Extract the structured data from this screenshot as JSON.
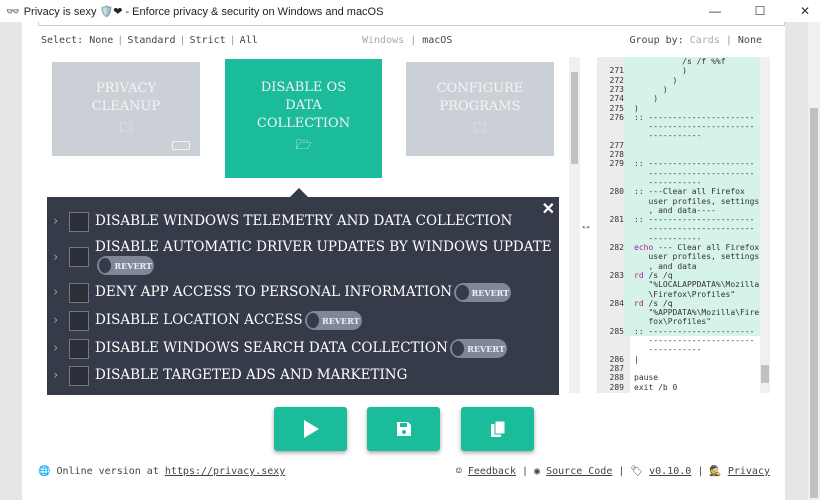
{
  "window": {
    "title": "Privacy is sexy 🛡️❤ - Enforce privacy & security on Windows and macOS",
    "minimize": "—",
    "maximize": "☐",
    "close": "✕"
  },
  "select": {
    "label": "Select:",
    "options": [
      "None",
      "Standard",
      "Strict",
      "All"
    ]
  },
  "os": {
    "options": [
      "Windows",
      "macOS"
    ],
    "selected": "macOS"
  },
  "group": {
    "label": "Group by:",
    "options": [
      "Cards",
      "None"
    ],
    "selected": "None"
  },
  "cards": [
    {
      "title": "PRIVACY CLEANUP",
      "icon": "folder-icon"
    },
    {
      "title": "DISABLE OS DATA COLLECTION",
      "icon": "folder-open-icon",
      "active": true
    },
    {
      "title": "CONFIGURE PROGRAMS",
      "icon": "folder-icon"
    }
  ],
  "scripts": {
    "close": "✕",
    "revert_label": "REVERT",
    "items": [
      {
        "label": "DISABLE WINDOWS TELEMETRY AND DATA COLLECTION",
        "revert": false
      },
      {
        "label": "DISABLE AUTOMATIC DRIVER UPDATES BY WINDOWS UPDATE",
        "revert": true
      },
      {
        "label": "DENY APP ACCESS TO PERSONAL INFORMATION",
        "revert": true
      },
      {
        "label": "DISABLE LOCATION ACCESS",
        "revert": true
      },
      {
        "label": "DISABLE WINDOWS SEARCH DATA COLLECTION",
        "revert": true
      },
      {
        "label": "DISABLE TARGETED ADS AND MARKETING",
        "revert": false
      }
    ]
  },
  "code": {
    "lines": [
      {
        "n": "",
        "t": "          /s /f %%f",
        "hl": true
      },
      {
        "n": "271",
        "t": "          )",
        "hl": true
      },
      {
        "n": "272",
        "t": "        )",
        "hl": true
      },
      {
        "n": "273",
        "t": "      )",
        "hl": true
      },
      {
        "n": "274",
        "t": "    )",
        "hl": true
      },
      {
        "n": "275",
        "t": ")",
        "hl": true
      },
      {
        "n": "276",
        "t": ":: ----------------------",
        "hl": true,
        "cls": "cm"
      },
      {
        "n": "",
        "t": "   ----------------------",
        "hl": true,
        "cls": "cm"
      },
      {
        "n": "",
        "t": "   -----------",
        "hl": true,
        "cls": "cm"
      },
      {
        "n": "277",
        "t": "",
        "hl": true
      },
      {
        "n": "278",
        "t": "",
        "hl": true
      },
      {
        "n": "279",
        "t": ":: ----------------------",
        "hl": true,
        "cls": "cm"
      },
      {
        "n": "",
        "t": "   ----------------------",
        "hl": true,
        "cls": "cm"
      },
      {
        "n": "",
        "t": "   -----------",
        "hl": true,
        "cls": "cm"
      },
      {
        "n": "280",
        "t": ":: ---Clear all Firefox",
        "hl": true,
        "cls": "cm"
      },
      {
        "n": "",
        "t": "   user profiles, settings",
        "hl": true,
        "cls": "cm"
      },
      {
        "n": "",
        "t": "   , and data----",
        "hl": true,
        "cls": "cm"
      },
      {
        "n": "281",
        "t": ":: ----------------------",
        "hl": true,
        "cls": "cm"
      },
      {
        "n": "",
        "t": "   ----------------------",
        "hl": true,
        "cls": "cm"
      },
      {
        "n": "",
        "t": "   -----------",
        "hl": true,
        "cls": "cm"
      },
      {
        "n": "282",
        "t": "echo --- Clear all Firefox",
        "hl": true,
        "cls": "echo"
      },
      {
        "n": "",
        "t": "   user profiles, settings",
        "hl": true
      },
      {
        "n": "",
        "t": "   , and data",
        "hl": true
      },
      {
        "n": "283",
        "t": "rd /s /q",
        "hl": true,
        "cls": "rd"
      },
      {
        "n": "",
        "t": "   \"%LOCALAPPDATA%\\Mozilla",
        "hl": true,
        "cls": "st"
      },
      {
        "n": "",
        "t": "   \\Firefox\\Profiles\"",
        "hl": true,
        "cls": "st"
      },
      {
        "n": "284",
        "t": "rd /s /q",
        "hl": true,
        "cls": "rd"
      },
      {
        "n": "",
        "t": "   \"%APPDATA%\\Mozilla\\Fire",
        "hl": true,
        "cls": "st"
      },
      {
        "n": "",
        "t": "   fox\\Profiles\"",
        "hl": true,
        "cls": "st"
      },
      {
        "n": "285",
        "t": ":: ----------------------",
        "hl": true,
        "cls": "cm"
      },
      {
        "n": "",
        "t": "   ----------------------",
        "cls": "cm"
      },
      {
        "n": "",
        "t": "   -----------",
        "cls": "cm"
      },
      {
        "n": "286",
        "t": "|"
      },
      {
        "n": "287",
        "t": ""
      },
      {
        "n": "288",
        "t": "pause",
        "cls": "kw"
      },
      {
        "n": "289",
        "t": "exit /b 0",
        "cls": "kw"
      }
    ]
  },
  "actions": [
    {
      "name": "run-button",
      "icon": "play-icon"
    },
    {
      "name": "save-button",
      "icon": "save-icon"
    },
    {
      "name": "copy-button",
      "icon": "copy-icon"
    }
  ],
  "footer": {
    "online_text": "Online version at",
    "online_link": "https://privacy.sexy",
    "feedback": "Feedback",
    "source": "Source Code",
    "version": "v0.10.0",
    "privacy": "Privacy"
  },
  "colors": {
    "accent": "#1abc9c",
    "panel": "#353b48",
    "card_inactive": "#cbd0d7"
  }
}
